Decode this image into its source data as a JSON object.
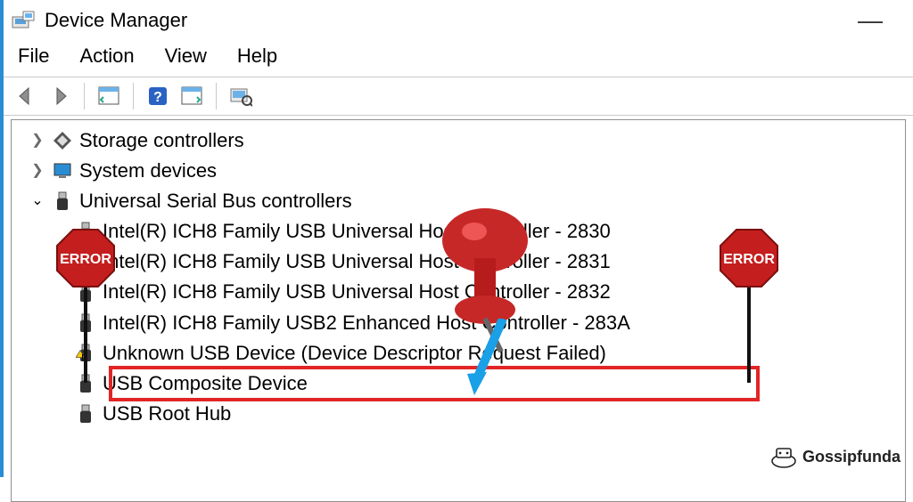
{
  "title": "Device Manager",
  "menu": {
    "file": "File",
    "action": "Action",
    "view": "View",
    "help": "Help"
  },
  "tree": {
    "storage": {
      "label": "Storage controllers"
    },
    "system": {
      "label": "System devices"
    },
    "usb": {
      "label": "Universal Serial Bus controllers",
      "children": [
        "Intel(R) ICH8 Family USB Universal Host Controller - 2830",
        "Intel(R) ICH8 Family USB Universal Host Controller - 2831",
        "Intel(R) ICH8 Family USB Universal Host Controller - 2832",
        "Intel(R) ICH8 Family USB2 Enhanced Host Controller - 283A",
        "Unknown USB Device (Device Descriptor Request Failed)",
        "USB Composite Device",
        "USB Root Hub"
      ]
    }
  },
  "badge": {
    "text": "ERROR"
  },
  "watermark": "Gossipfunda"
}
